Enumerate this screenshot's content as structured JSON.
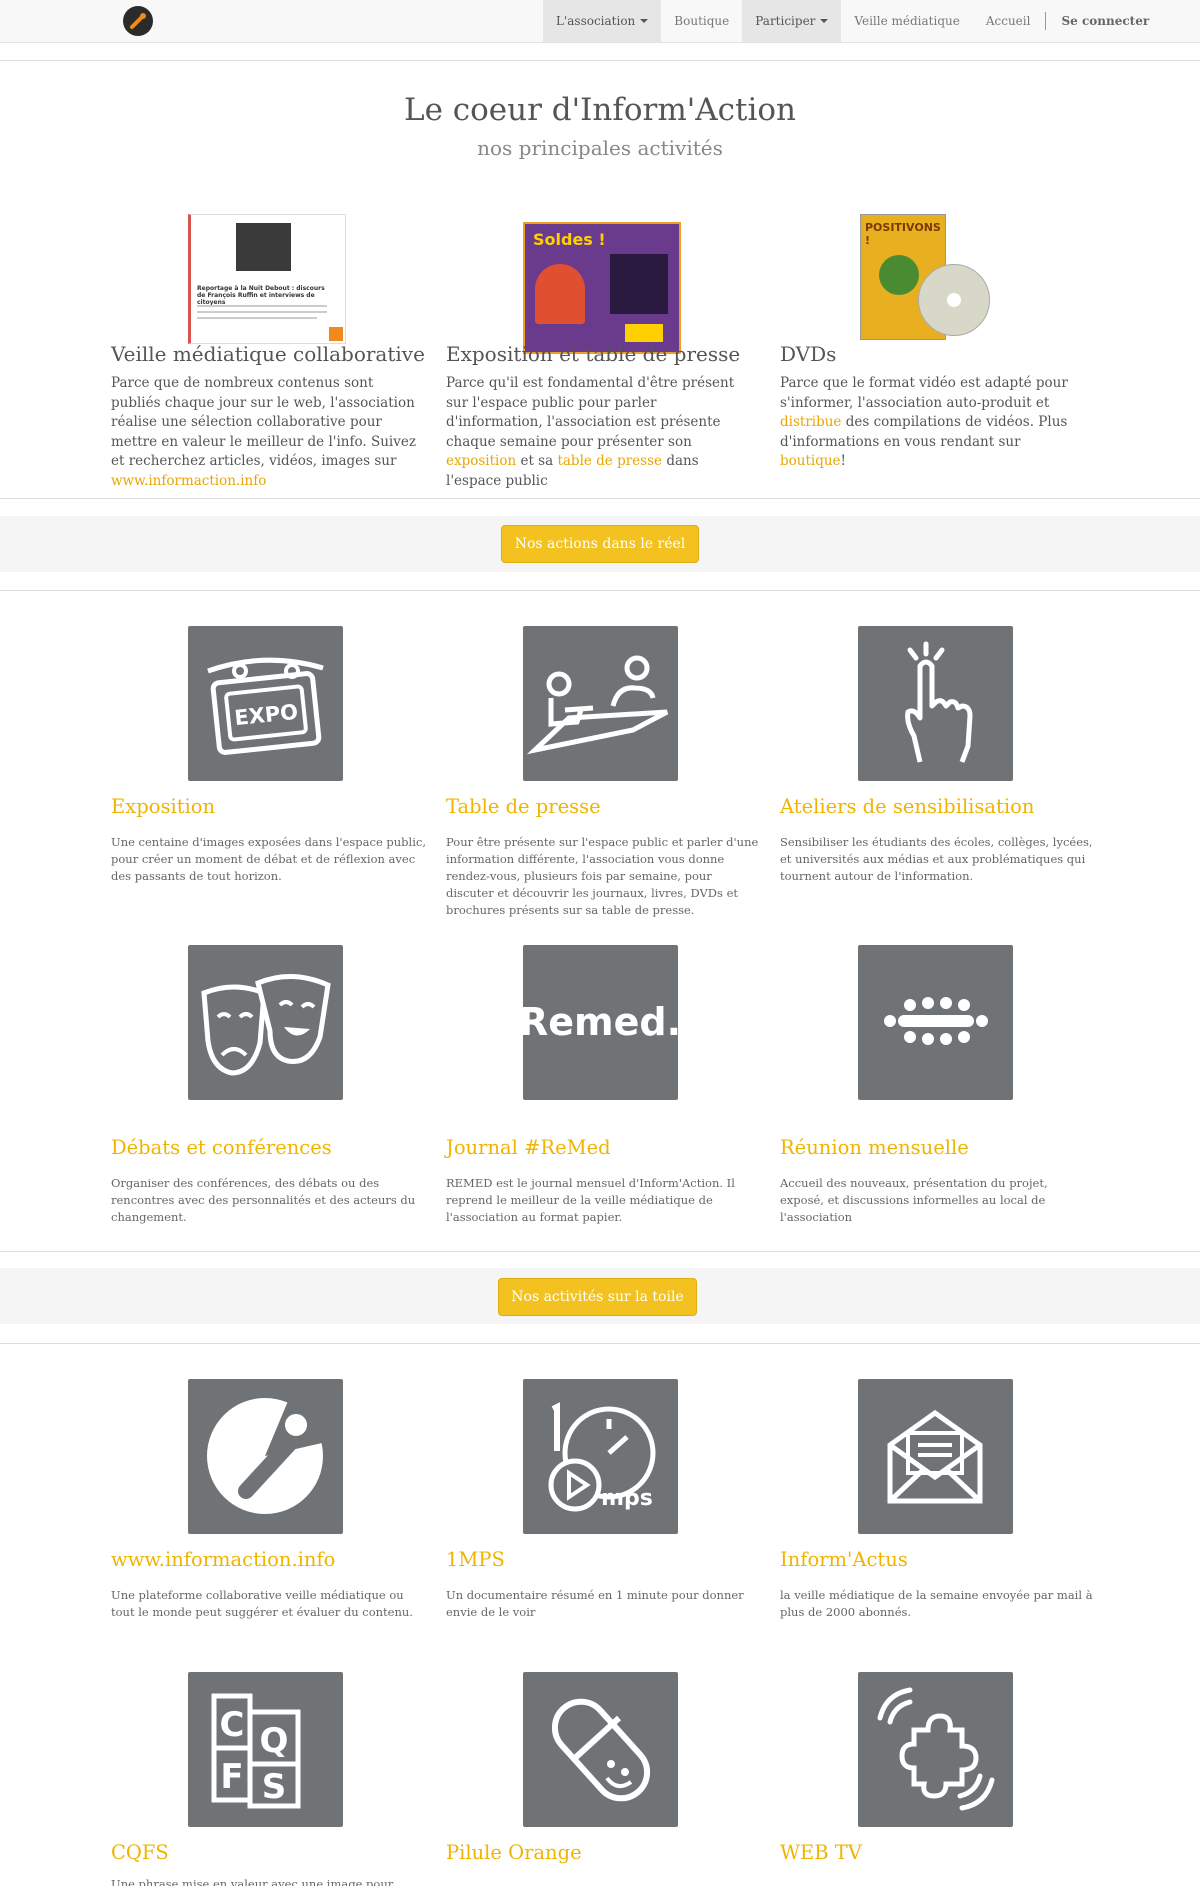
{
  "nav": {
    "items": [
      {
        "label": "L'association",
        "dropdown": true,
        "active": true
      },
      {
        "label": "Boutique",
        "dropdown": false,
        "active": false
      },
      {
        "label": "Participer",
        "dropdown": true,
        "active": true
      },
      {
        "label": "Veille médiatique",
        "dropdown": false,
        "active": false
      },
      {
        "label": "Accueil",
        "dropdown": false,
        "active": false
      }
    ],
    "login_label": "Se connecter"
  },
  "hero": {
    "title": "Le coeur d'Inform'Action",
    "subtitle": "nos principales activités"
  },
  "features": [
    {
      "title": "Veille médiatique collaborative",
      "text_before": "Parce que de nombreux contenus sont publiés chaque jour sur le web, l'association réalise une sélection collaborative pour mettre en valeur le meilleur de l'info. Suivez et recherchez articles, vidéos, images sur ",
      "link": "www.informaction.info",
      "text_after": "",
      "image_caption": "Reportage à la Nuit Debout : discours de François Ruffin et interviews de citoyens"
    },
    {
      "title": "Exposition et table de presse",
      "text_before": "Parce qu'il est fondamental d'être présent sur l'espace public pour parler d'information, l'association est présente chaque semaine pour présenter son ",
      "link": "exposition",
      "text_mid": " et sa ",
      "link2": "table de presse",
      "text_after": " dans l'espace public",
      "image_caption": "Soldes !"
    },
    {
      "title": "DVDs",
      "text_before": "Parce que le format vidéo est adapté pour s'informer, l'association auto-produit et ",
      "link": "distribue",
      "text_mid": " des compilations de vidéos. Plus d'informations en vous rendant sur ",
      "link2": "boutique",
      "text_after": "!",
      "image_caption": "POSITIVONS !"
    }
  ],
  "section_buttons": {
    "real": "Nos actions dans le réel",
    "web": "Nos activités sur la toile"
  },
  "real_actions": [
    {
      "title": "Exposition",
      "icon": "expo-icon",
      "icon_text": "EXPO",
      "text": "Une centaine d'images exposées dans l'espace public, pour créer un moment de débat et de réflexion avec des passants de tout horizon."
    },
    {
      "title": "Table de presse",
      "icon": "press-table-icon",
      "text": "Pour être présente sur l'espace public et parler d'une information différente, l'association vous donne rendez-vous, plusieurs fois par semaine, pour discuter et découvrir les journaux, livres, DVDs et brochures présents sur sa table de presse."
    },
    {
      "title": "Ateliers de sensibilisation",
      "icon": "pointing-hand-icon",
      "text": "Sensibiliser les étudiants des écoles, collèges, lycées, et universités aux médias et aux problématiques qui tournent autour de l'information."
    },
    {
      "title": "Débats et conférences",
      "icon": "theater-masks-icon",
      "text": "Organiser des conférences, des débats ou des rencontres avec des personnalités et des acteurs du changement."
    },
    {
      "title": "Journal #ReMed",
      "icon": "remed-logo-icon",
      "icon_text": "Remed.",
      "text": "REMED est le journal mensuel d'Inform'Action. Il reprend le meilleur de la veille médiatique de l'association au format papier."
    },
    {
      "title": "Réunion mensuelle",
      "icon": "meeting-table-icon",
      "text": "Accueil des nouveaux, présentation du projet, exposé, et discussions informelles au local de l'association"
    }
  ],
  "web_actions": [
    {
      "title": "www.informaction.info",
      "icon": "microphone-icon",
      "text": "Une plateforme collaborative veille médiatique ou tout le monde peut suggérer et évaluer du contenu."
    },
    {
      "title": "1MPS",
      "icon": "clock-play-icon",
      "icon_text": "mps",
      "text": "Un documentaire résumé en 1 minute pour donner envie de le voir"
    },
    {
      "title": "Inform'Actus",
      "icon": "envelope-icon",
      "text": "la veille médiatique de la semaine envoyée par mail à plus de 2000 abonnés."
    },
    {
      "title": "CQFS",
      "icon": "cqfs-letters-icon",
      "icon_text": "CQFS",
      "text": "Une phrase mise en valeur avec une image pour donner"
    },
    {
      "title": "Pilule Orange",
      "icon": "pill-icon",
      "text": ""
    },
    {
      "title": "WEB TV",
      "icon": "puzzle-broadcast-icon",
      "text": ""
    }
  ],
  "colors": {
    "accent": "#f3c221",
    "link": "#e8a600",
    "tile": "#707375",
    "card_title": "#f0b400"
  }
}
